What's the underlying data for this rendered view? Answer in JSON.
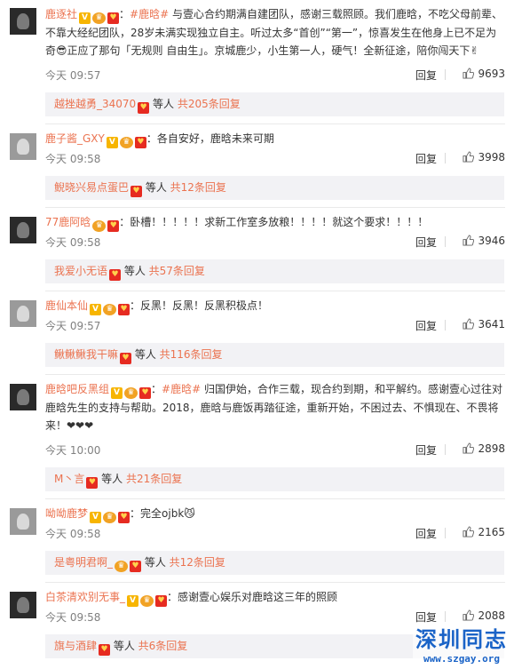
{
  "colors": {
    "accent": "#eb7350",
    "link": "#eb7350",
    "sub_bg": "#f2f2f5",
    "meta": "#808080",
    "watermark": "#1a63c7"
  },
  "icons": {
    "like": "thumbs-up-icon",
    "verified": "v-badge-icon",
    "vip": "vip-icon",
    "fan": "fan-badge-icon"
  },
  "comments": [
    {
      "user": "鹿逐社",
      "text_after_user": "：",
      "hashtag": "#鹿晗#",
      "text": " 与壹心合约期满自建团队，感谢三载照顾。我们鹿晗，不吃父母前辈、不靠大经纪团队，28岁未满实现独立自主。听过太多“首创”“第一”，惊喜发生在他身上已不足为奇😎正应了那句「无规则 自由生」。京城鹿少，小生第一人，硬气！全新征途，陪你闯天下✌",
      "time": "今天 09:57",
      "reply_label": "回复",
      "likes": "9693",
      "sub_user": "越挫越勇_34070",
      "sub_text": " 等人 ",
      "sub_count": "共205条回复"
    },
    {
      "user": "鹿子酱_GXY",
      "text_after_user": "：",
      "hashtag": "",
      "text": "各自安好，鹿晗未来可期",
      "time": "今天 09:58",
      "reply_label": "回复",
      "likes": "3998",
      "sub_user": "鲵晓兴易点蛋巴",
      "sub_text": " 等人 ",
      "sub_count": "共12条回复"
    },
    {
      "user": "77鹿阿晗",
      "text_after_user": "：",
      "hashtag": "",
      "text": "卧槽！！！！！求新工作室多放粮！！！！就这个要求！！！！",
      "time": "今天 09:58",
      "reply_label": "回复",
      "likes": "3946",
      "sub_user": "我爱小无语",
      "sub_text": " 等人 ",
      "sub_count": "共57条回复"
    },
    {
      "user": "鹿仙本仙",
      "text_after_user": "：",
      "hashtag": "",
      "text": "反黑！反黑！反黑积极点！",
      "time": "今天 09:57",
      "reply_label": "回复",
      "likes": "3641",
      "sub_user": "鳅鳅鳅我干嘛",
      "sub_text": " 等人 ",
      "sub_count": "共116条回复"
    },
    {
      "user": "鹿晗吧反黑组",
      "text_after_user": "：",
      "hashtag": "#鹿晗#",
      "text": " 归国伊始，合作三载，现合约到期，和平解约。感谢壹心过往对鹿晗先生的支持与帮助。2018，鹿晗与鹿饭再踏征途，重新开始，不困过去、不惧现在、不畏将来！❤❤❤",
      "time": "今天 10:00",
      "reply_label": "回复",
      "likes": "2898",
      "sub_user": "M丶言",
      "sub_text": " 等人 ",
      "sub_count": "共21条回复"
    },
    {
      "user": "呦呦鹿梦",
      "text_after_user": "：",
      "hashtag": "",
      "text": "完全ojbk😼",
      "time": "今天 09:58",
      "reply_label": "回复",
      "likes": "2165",
      "sub_user": "是粤明君啊_",
      "sub_text": " 等人 ",
      "sub_count": "共12条回复"
    },
    {
      "user": "白茶清欢别无事_",
      "text_after_user": "：",
      "hashtag": "",
      "text": "感谢壹心娱乐对鹿晗这三年的照顾",
      "time": "今天 09:58",
      "reply_label": "回复",
      "likes": "2088",
      "sub_user": "旗与酒肆",
      "sub_text": " 等人 ",
      "sub_count": "共6条回复"
    }
  ],
  "watermark": {
    "title": "深圳同志",
    "url": "www.szgay.org"
  }
}
